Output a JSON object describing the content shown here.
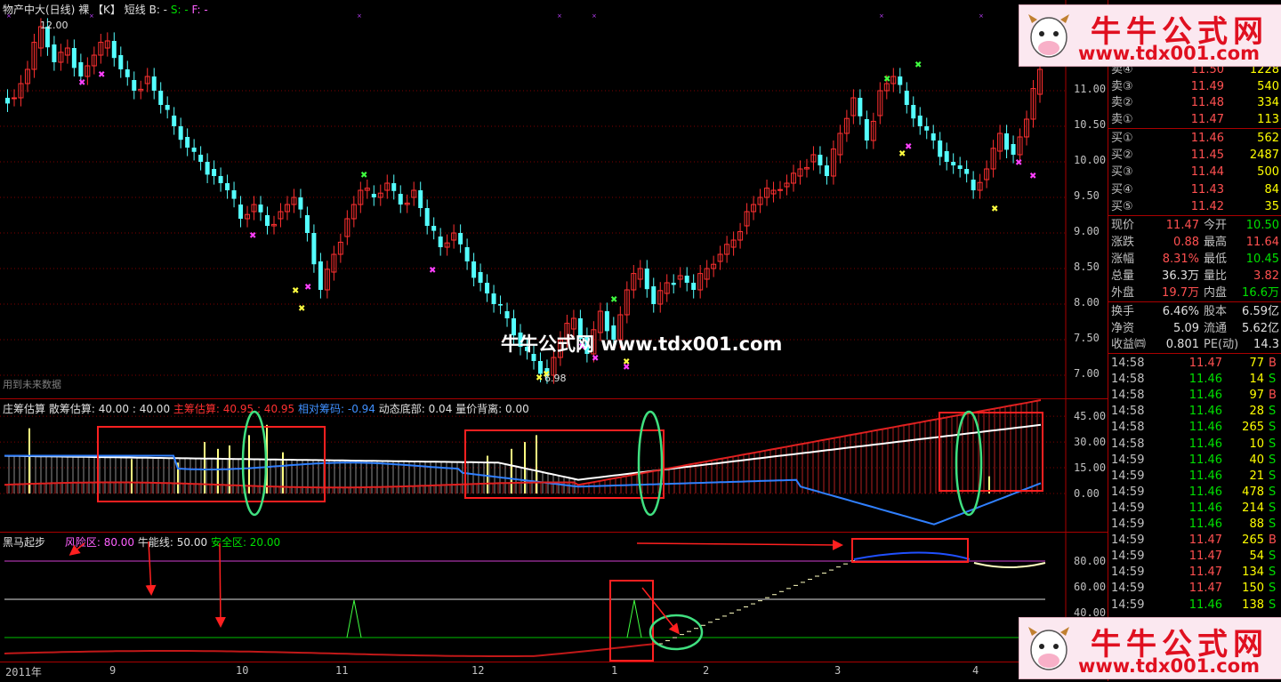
{
  "main": {
    "title": "物产中大(日线)",
    "mode": "裸",
    "k": "【K】",
    "line": "短线",
    "b_label": "B: -",
    "s_label": "S: -",
    "f_label": "F: -",
    "high_label": "12.00",
    "low_label": "6.98",
    "future_note": "用到未来数据",
    "watermark": "牛牛公式网 www.tdx001.com",
    "y_ticks": [
      "11.00",
      "10.50",
      "10.00",
      "9.50",
      "9.00",
      "8.50",
      "8.00",
      "7.50",
      "7.00"
    ]
  },
  "ind1": {
    "label": "庄筹估算",
    "scatter": "散筹估算: 40.00 : 40.00",
    "main_chip": "主筹估算: 40.95 : 40.95",
    "relative": "相对筹码: -0.94",
    "bottom": "动态底部: 0.04",
    "divergence": "量价背离: 0.00",
    "y_ticks": [
      "45.00",
      "30.00",
      "15.00",
      "0.00"
    ]
  },
  "ind2": {
    "label": "黑马起步",
    "risk": "风险区: 80.00",
    "bull": "牛能线: 50.00",
    "safe": "安全区: 20.00",
    "y_ticks": [
      "80.00",
      "60.00",
      "40.00"
    ]
  },
  "xaxis": [
    "2011年",
    "9",
    "10",
    "11",
    "12",
    "1",
    "2",
    "3",
    "4"
  ],
  "quote": {
    "sell": [
      {
        "label": "卖④",
        "price": "11.50",
        "vol": "1228"
      },
      {
        "label": "卖③",
        "price": "11.49",
        "vol": "540"
      },
      {
        "label": "卖②",
        "price": "11.48",
        "vol": "334"
      },
      {
        "label": "卖①",
        "price": "11.47",
        "vol": "113"
      }
    ],
    "buy": [
      {
        "label": "买①",
        "price": "11.46",
        "vol": "562"
      },
      {
        "label": "买②",
        "price": "11.45",
        "vol": "2487"
      },
      {
        "label": "买③",
        "price": "11.44",
        "vol": "500"
      },
      {
        "label": "买④",
        "price": "11.43",
        "vol": "84"
      },
      {
        "label": "买⑤",
        "price": "11.42",
        "vol": "35"
      }
    ],
    "stats": [
      {
        "k1": "现价",
        "v1": "11.47",
        "k2": "今开",
        "v2": "10.50"
      },
      {
        "k1": "涨跌",
        "v1": "0.88",
        "k2": "最高",
        "v2": "11.64"
      },
      {
        "k1": "涨幅",
        "v1": "8.31%",
        "k2": "最低",
        "v2": "10.45"
      },
      {
        "k1": "总量",
        "v1": "36.3万",
        "k2": "量比",
        "v2": "3.82"
      },
      {
        "k1": "外盘",
        "v1": "19.7万",
        "k2": "内盘",
        "v2": "16.6万"
      }
    ],
    "stats2": [
      {
        "k1": "换手",
        "v1": "6.46%",
        "k2": "股本",
        "v2": "6.59亿"
      },
      {
        "k1": "净资",
        "v1": "5.09",
        "k2": "流通",
        "v2": "5.62亿"
      },
      {
        "k1": "收益㈣",
        "v1": "0.801",
        "k2": "PE(动)",
        "v2": "14.3"
      }
    ],
    "ticks": [
      {
        "t": "14:58",
        "p": "11.47",
        "v": "77",
        "s": "B"
      },
      {
        "t": "14:58",
        "p": "11.46",
        "v": "14",
        "s": "S"
      },
      {
        "t": "14:58",
        "p": "11.46",
        "v": "97",
        "s": "B"
      },
      {
        "t": "14:58",
        "p": "11.46",
        "v": "28",
        "s": "S"
      },
      {
        "t": "14:58",
        "p": "11.46",
        "v": "265",
        "s": "S"
      },
      {
        "t": "14:58",
        "p": "11.46",
        "v": "10",
        "s": "S"
      },
      {
        "t": "14:59",
        "p": "11.46",
        "v": "40",
        "s": "S"
      },
      {
        "t": "14:59",
        "p": "11.46",
        "v": "21",
        "s": "S"
      },
      {
        "t": "14:59",
        "p": "11.46",
        "v": "478",
        "s": "S"
      },
      {
        "t": "14:59",
        "p": "11.46",
        "v": "214",
        "s": "S"
      },
      {
        "t": "14:59",
        "p": "11.46",
        "v": "88",
        "s": "S"
      },
      {
        "t": "14:59",
        "p": "11.47",
        "v": "265",
        "s": "B"
      },
      {
        "t": "14:59",
        "p": "11.47",
        "v": "54",
        "s": "S"
      },
      {
        "t": "14:59",
        "p": "11.47",
        "v": "134",
        "s": "S"
      },
      {
        "t": "14:59",
        "p": "11.47",
        "v": "150",
        "s": "S"
      },
      {
        "t": "14:59",
        "p": "11.46",
        "v": "138",
        "s": "S"
      }
    ]
  },
  "logo": {
    "cn": "牛牛公式网",
    "url": "www.tdx001.com"
  },
  "colors": {
    "up": "#ff3030",
    "down": "#54ffff",
    "grid": "#800000"
  }
}
